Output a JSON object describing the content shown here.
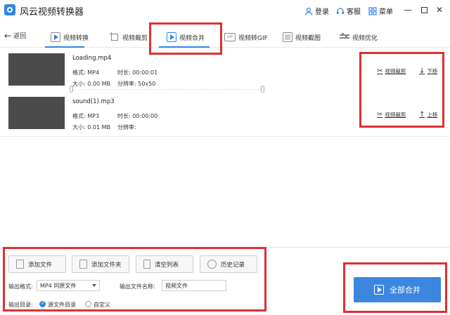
{
  "app": {
    "title": "风云视频转换器",
    "login": "登录",
    "service": "客服",
    "menu": "菜单"
  },
  "nav": {
    "back": "返回",
    "tabs": [
      {
        "label": "视频转换",
        "icon": "play-icon"
      },
      {
        "label": "视频裁剪",
        "icon": "crop-icon"
      },
      {
        "label": "视频合并",
        "icon": "merge-icon"
      },
      {
        "label": "视频转GIF",
        "icon": "gif-icon"
      },
      {
        "label": "视频截图",
        "icon": "screenshot-icon"
      },
      {
        "label": "视频优化",
        "icon": "sliders-icon"
      }
    ],
    "active_tab": "视频合并"
  },
  "files": [
    {
      "name": "Loading.mp4",
      "format": "格式: MP4",
      "duration": "时长: 00:00:01",
      "size": "大小: 0.00 MB",
      "resolution": "分辨率: 50x50",
      "crop_label": "视频裁剪",
      "move_label": "下移",
      "move_icon": "arrow-down-icon"
    },
    {
      "name": "sound(1).mp3",
      "format": "格式: MP3",
      "duration": "时长: 00:00:00",
      "size": "大小: 0.01 MB",
      "resolution": "分辨率:",
      "crop_label": "视频裁剪",
      "move_label": "上移",
      "move_icon": "arrow-up-icon"
    }
  ],
  "bottom": {
    "buttons": {
      "add_file": "添加文件",
      "add_folder": "添加文件夹",
      "clear_list": "清空列表",
      "history": "历史记录"
    },
    "output_format_label": "输出格式:",
    "output_format_value": "MP4 同原文件",
    "output_name_label": "输出文件名称:",
    "output_name_value": "视频文件",
    "output_dir_label": "输出目录:",
    "dir_option_source": "源文件目录",
    "dir_option_custom": "自定义",
    "merge_all": "全部合并"
  },
  "colors": {
    "accent": "#2f86e6",
    "merge_button": "#3d86e0",
    "highlight_box": "#e03030"
  }
}
